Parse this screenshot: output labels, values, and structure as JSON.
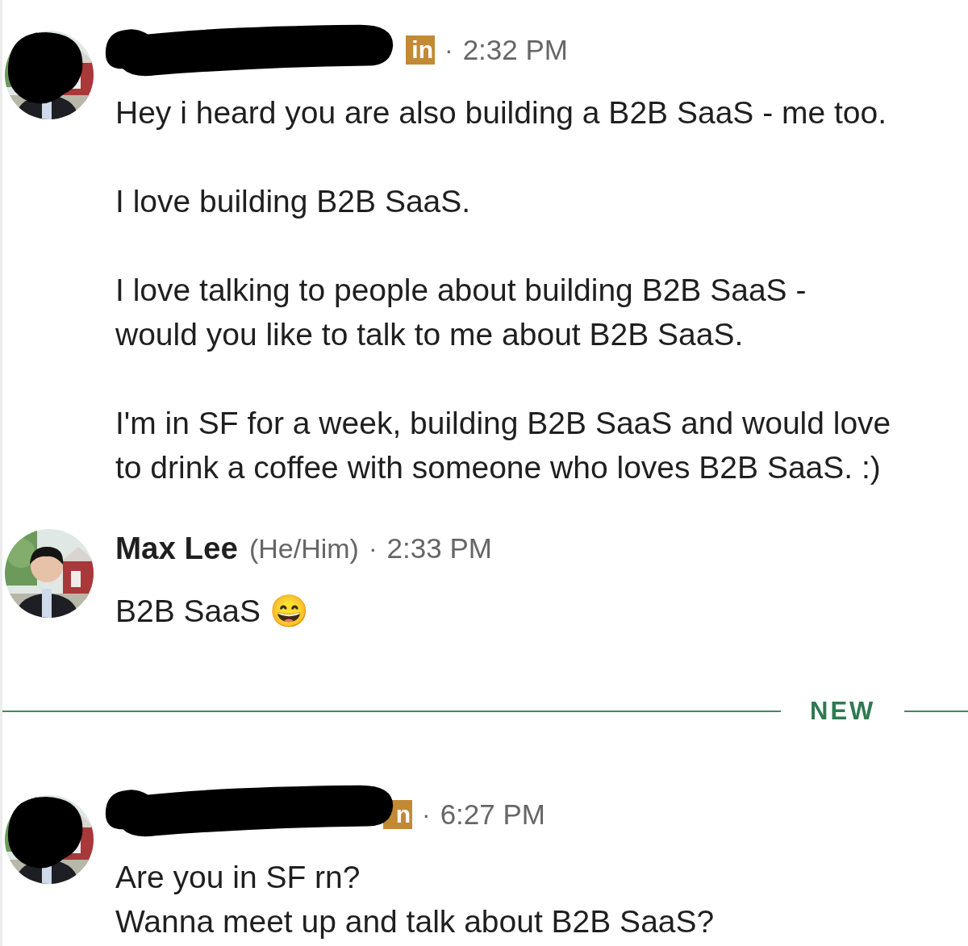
{
  "messages": [
    {
      "avatar": {
        "kind": "picture",
        "redacted": true
      },
      "sender": {
        "redacted": true
      },
      "badge": "in",
      "separator": "·",
      "time": "2:32 PM",
      "paragraphs": [
        "Hey i heard you are also building a B2B SaaS - me too.",
        "I love building B2B SaaS.",
        "I love talking to people about building B2B SaaS -\nwould you like to talk to me about B2B SaaS.",
        "I'm in SF for a week, building B2B SaaS and would love\nto drink a coffee with someone who loves B2B SaaS. :)"
      ]
    },
    {
      "avatar": {
        "kind": "picture",
        "redacted": false
      },
      "sender": {
        "name": "Max Lee",
        "pronouns": "(He/Him)",
        "redacted": false
      },
      "separator": "·",
      "time": "2:33 PM",
      "paragraphs": [
        "B2B SaaS 😄"
      ]
    }
  ],
  "divider": {
    "label": "NEW"
  },
  "new_messages": [
    {
      "avatar": {
        "kind": "picture",
        "redacted": true
      },
      "sender": {
        "redacted": true
      },
      "badge": "n",
      "separator": "·",
      "time": "6:27 PM",
      "paragraphs": [
        "Are you in SF rn?\nWanna meet up and talk about B2B SaaS?"
      ]
    }
  ]
}
